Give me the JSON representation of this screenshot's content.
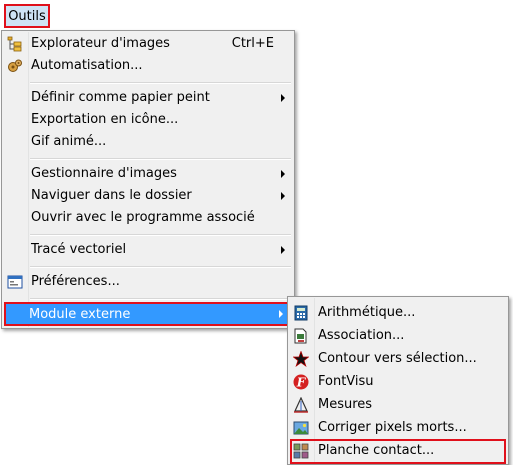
{
  "menubar": {
    "outils_label": "Outils"
  },
  "main_menu": {
    "explorer": {
      "label": "Explorateur d'images",
      "shortcut": "Ctrl+E",
      "icon": "explorer-tree-icon"
    },
    "automation": {
      "label": "Automatisation...",
      "icon": "gears-icon"
    },
    "wallpaper": {
      "label": "Définir comme papier peint"
    },
    "export_icon": {
      "label": "Exportation en icône..."
    },
    "gif": {
      "label": "Gif animé..."
    },
    "image_manager": {
      "label": "Gestionnaire d'images"
    },
    "browse_folder": {
      "label": "Naviguer dans le dossier"
    },
    "open_with": {
      "label": "Ouvrir avec le programme associé"
    },
    "vector": {
      "label": "Tracé vectoriel"
    },
    "preferences": {
      "label": "Préférences...",
      "icon": "preferences-window-icon"
    },
    "plugin": {
      "label": "Module externe"
    }
  },
  "sub_menu": {
    "arith": {
      "label": "Arithmétique...",
      "icon": "calculator-icon"
    },
    "assoc": {
      "label": "Association...",
      "icon": "file-association-icon"
    },
    "contour": {
      "label": "Contour vers sélection...",
      "icon": "star-icon"
    },
    "fontvisu": {
      "label": "FontVisu",
      "icon": "fontvisu-icon"
    },
    "mesures": {
      "label": "Mesures",
      "icon": "measure-icon"
    },
    "dead_pixels": {
      "label": "Corriger pixels morts...",
      "icon": "picture-fix-icon"
    },
    "contact_sheet": {
      "label": "Planche contact...",
      "icon": "contact-sheet-icon"
    }
  },
  "colors": {
    "highlight": "#3399ff",
    "annotation": "#e0101b",
    "menu_bg": "#f0f0f0"
  }
}
